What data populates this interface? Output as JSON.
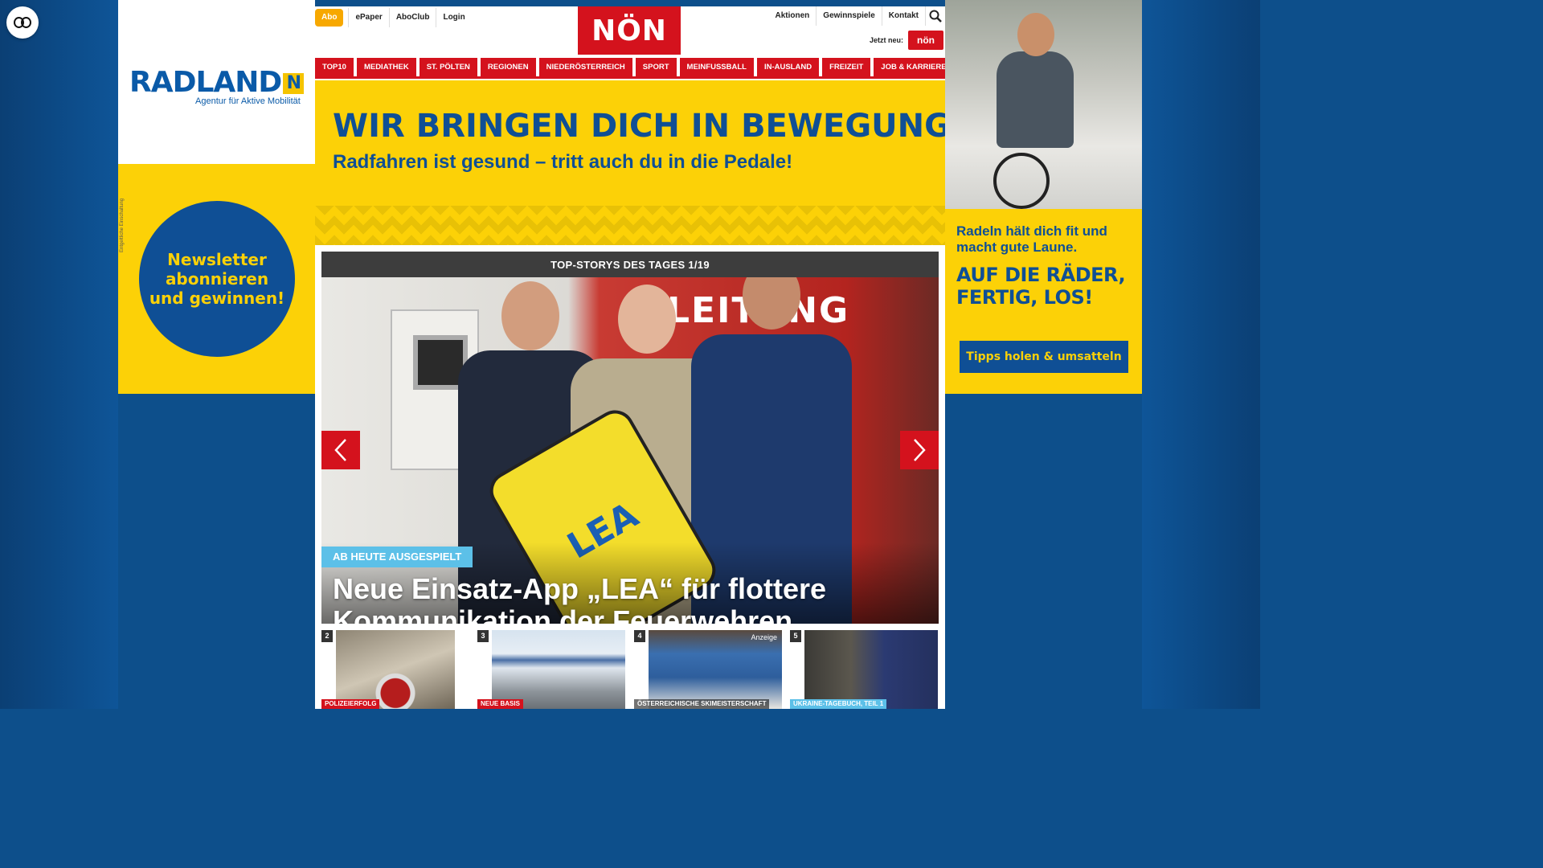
{
  "accessibility": {
    "icon": "accessibility-icon"
  },
  "left_ad": {
    "logo_text": "RADLAND",
    "logo_badge": "N",
    "logo_sub": "Agentur für Aktive Mobilität",
    "circle_text": "Newsletter abonnieren und gewinnen!",
    "fine_print": "Entgeltliche Einschaltung"
  },
  "right_ad": {
    "text1": "Radeln hält dich fit und macht gute Laune.",
    "text2": "AUF DIE RÄDER, FERTIG, LOS!",
    "button": "Tipps holen & umsatteln"
  },
  "header": {
    "abo": "Abo",
    "left_links": [
      "ePaper",
      "AboClub",
      "Login"
    ],
    "logo": "NÖN",
    "right_links": [
      "Aktionen",
      "Gewinnspiele",
      "Kontakt"
    ],
    "jetzt_neu": "Jetzt neu:",
    "kids_logo": "nön"
  },
  "categories": [
    "TOP10",
    "MEDIATHEK",
    "ST. PÖLTEN",
    "REGIONEN",
    "NIEDERÖSTERREICH",
    "SPORT",
    "MEINFUSSBALL",
    "IN-AUSLAND",
    "FREIZEIT",
    "JOB & KARRIERE"
  ],
  "banner": {
    "headline": "WIR BRINGEN DICH IN BEWEGUNG.",
    "subline": "Radfahren ist gesund – tritt auch du in die Pedale!"
  },
  "slider": {
    "header": "TOP-STORYS DES TAGES 1/19",
    "truck_text": "LEITUNG",
    "phone_text": "LEA",
    "kicker": "AB HEUTE AUSGESPIELT",
    "headline": "Neue Einsatz-App „LEA“ für flottere Kommunikation der Feuerwehren"
  },
  "thumbs": [
    {
      "num": "2",
      "tag": "POLIZEIERFOLG",
      "anzeige": ""
    },
    {
      "num": "3",
      "tag": "NEUE BASIS",
      "anzeige": ""
    },
    {
      "num": "4",
      "tag": "ÖSTERREICHISCHE SKIMEISTERSCHAFT",
      "anzeige": "Anzeige"
    },
    {
      "num": "5",
      "tag": "UKRAINE-TAGEBUCH, TEIL 1",
      "anzeige": ""
    }
  ],
  "colors": {
    "brand_red": "#d4121d",
    "ad_yellow": "#fcd107",
    "ad_blue": "#0f4f95",
    "kicker_blue": "#5cc0e8",
    "abo_orange": "#f7a800"
  }
}
